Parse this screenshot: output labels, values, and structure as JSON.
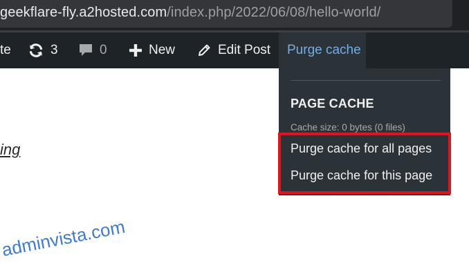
{
  "browser": {
    "url_host": "geekflare-fly.a2hosted.com",
    "url_path": "/index.php/2022/06/08/hello-world/"
  },
  "admin_bar": {
    "site_fragment": "te",
    "updates_count": "3",
    "comments_count": "0",
    "new_label": "New",
    "edit_post_label": "Edit Post",
    "purge_cache_label": "Purge cache"
  },
  "purge_menu": {
    "heading": "PAGE CACHE",
    "cache_info": "Cache size: 0 bytes (0 files)",
    "purge_all_label": "Purge cache for all pages",
    "purge_page_label": "Purge cache for this page",
    "highlight_color": "#e8101a"
  },
  "content": {
    "link_fragment": "ing"
  },
  "watermark": {
    "text": "adminvista.com"
  },
  "colors": {
    "admin_bar_bg": "#1d2327",
    "menu_bg": "#2c3338",
    "link_blue": "#72aee6"
  }
}
